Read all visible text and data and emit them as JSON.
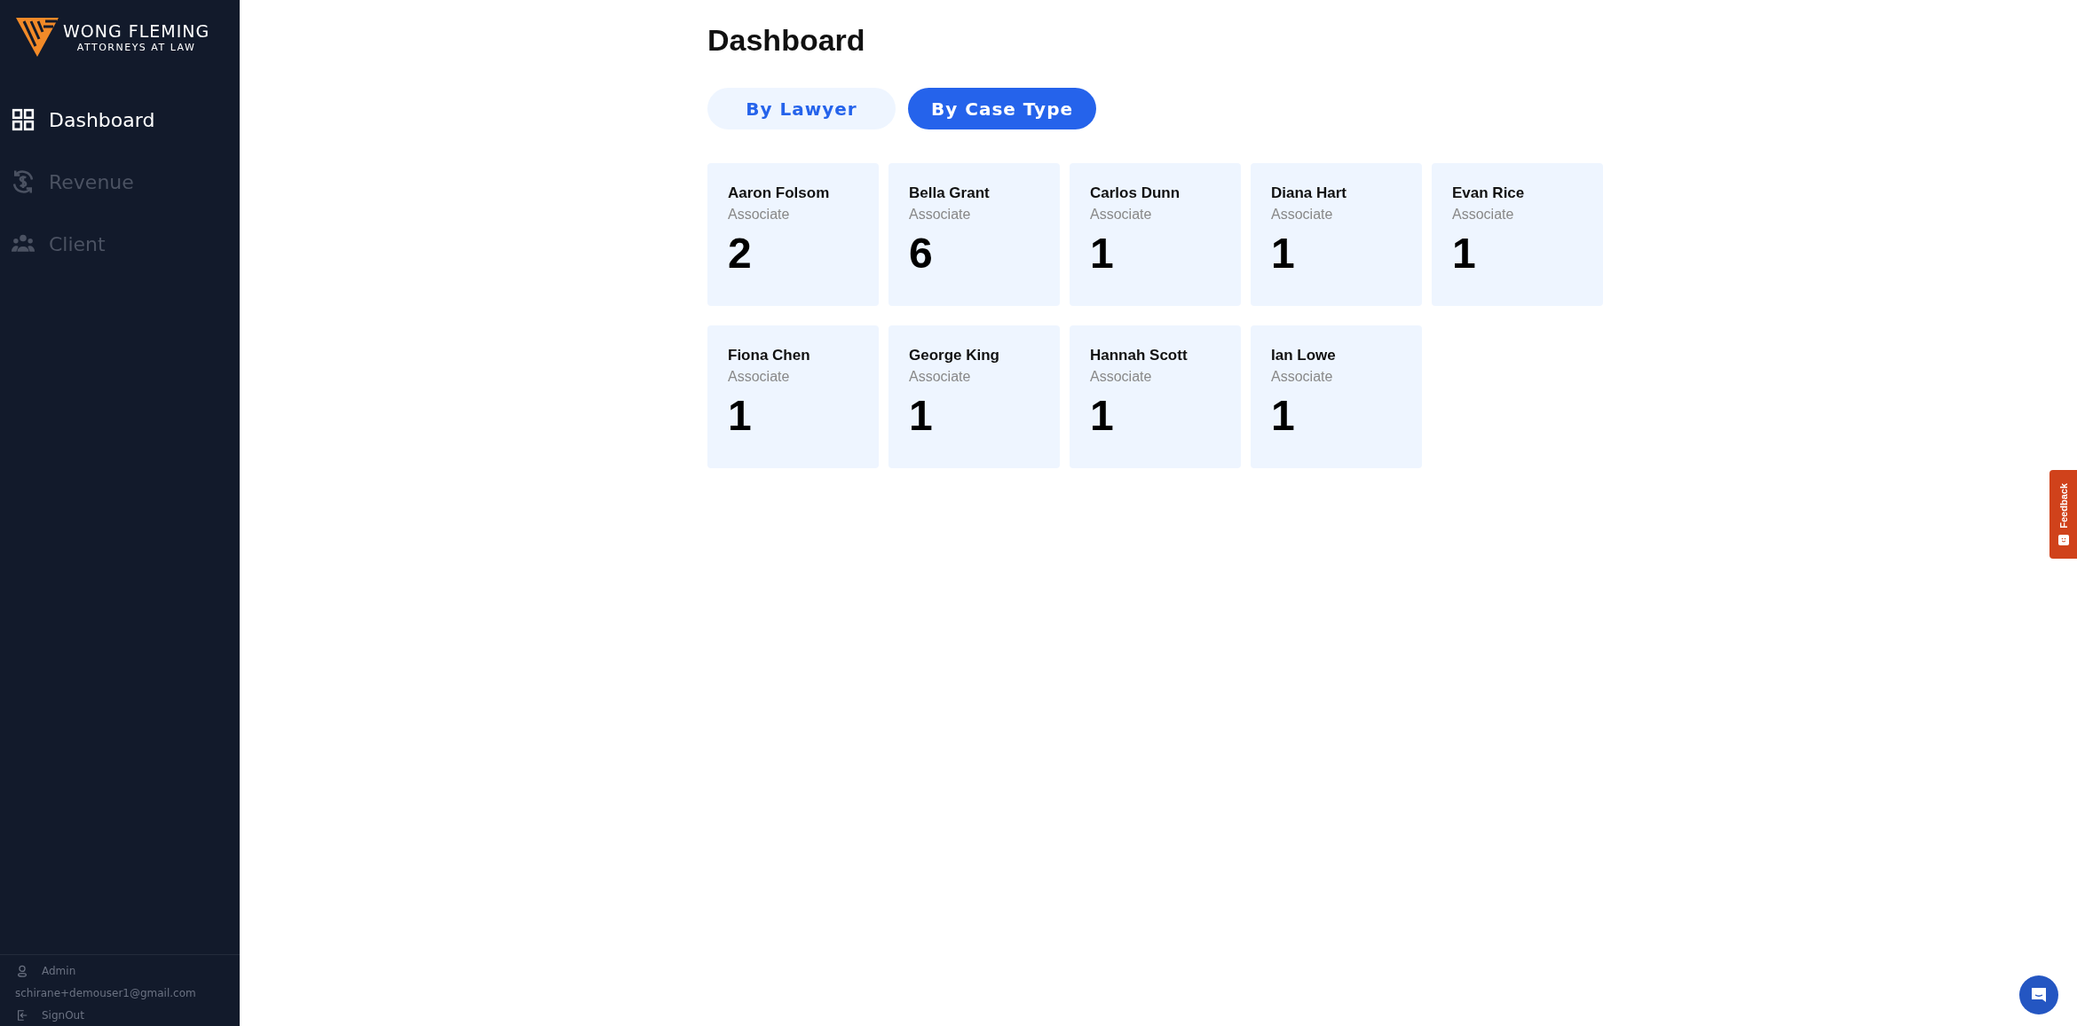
{
  "logo": {
    "name": "WONG FLEMING",
    "tagline": "ATTORNEYS AT LAW"
  },
  "sidebar": {
    "items": [
      {
        "label": "Dashboard",
        "kind": "grid",
        "selected": true
      },
      {
        "label": "Revenue",
        "kind": "dollar",
        "selected": false
      },
      {
        "label": "Client",
        "kind": "people",
        "selected": false
      }
    ]
  },
  "user": {
    "role": "Admin",
    "email": "schirane+demouser1@gmail.com",
    "sign_out": "SignOut"
  },
  "page": {
    "title": "Dashboard"
  },
  "tabs": [
    {
      "label": "By Lawyer",
      "selected": false
    },
    {
      "label": "By Case Type",
      "selected": true
    }
  ],
  "cards": [
    {
      "name": "Aaron Folsom",
      "role": "Associate",
      "count": "2"
    },
    {
      "name": "Bella Grant",
      "role": "Associate",
      "count": "6"
    },
    {
      "name": "Carlos Dunn",
      "role": "Associate",
      "count": "1"
    },
    {
      "name": "Diana Hart",
      "role": "Associate",
      "count": "1"
    },
    {
      "name": "Evan Rice",
      "role": "Associate",
      "count": "1"
    },
    {
      "name": "Fiona Chen",
      "role": "Associate",
      "count": "1"
    },
    {
      "name": "George King",
      "role": "Associate",
      "count": "1"
    },
    {
      "name": "Hannah Scott",
      "role": "Associate",
      "count": "1"
    },
    {
      "name": "Ian Lowe",
      "role": "Associate",
      "count": "1"
    }
  ],
  "feedback": {
    "label": "Feedback"
  }
}
